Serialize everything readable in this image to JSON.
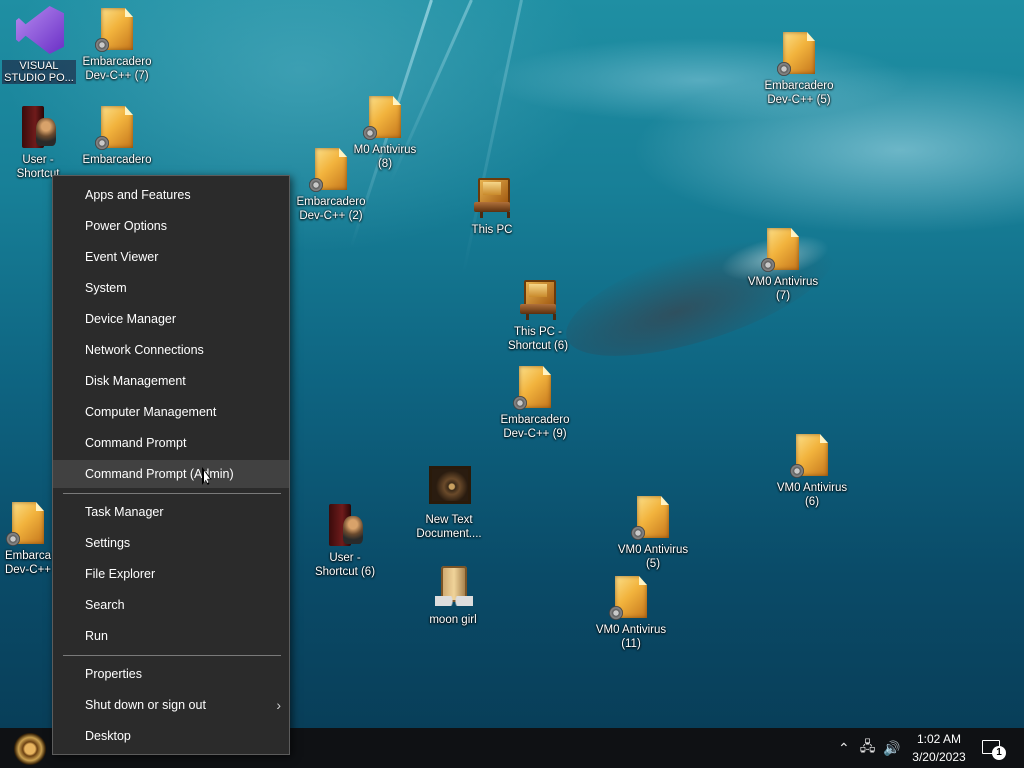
{
  "desktop": {
    "icons": [
      {
        "id": "vs",
        "label": "VISUAL STUDIO PO...",
        "overlay": "V'OVRAL S"
      },
      {
        "id": "dev7",
        "label": "Embarcadero Dev-C++ (7)"
      },
      {
        "id": "user1",
        "label": "User - Shortcut"
      },
      {
        "id": "dev_top2",
        "label": "Embarcadero"
      },
      {
        "id": "m0_8",
        "label": "M0 Antivirus (8)"
      },
      {
        "id": "dev2",
        "label": "Embarcadero Dev-C++ (2)"
      },
      {
        "id": "thispc",
        "label": "This PC"
      },
      {
        "id": "dev5",
        "label": "Embarcadero Dev-C++ (5)"
      },
      {
        "id": "vm0_7",
        "label": "VM0 Antivirus (7)"
      },
      {
        "id": "thispc6",
        "label": "This PC - Shortcut (6)"
      },
      {
        "id": "dev9",
        "label": "Embarcadero Dev-C++ (9)"
      },
      {
        "id": "vm0_6",
        "label": "VM0 Antivirus (6)"
      },
      {
        "id": "newtext",
        "label": "New Text Document...."
      },
      {
        "id": "vm0_5",
        "label": "VM0 Antivirus (5)"
      },
      {
        "id": "user6",
        "label": "User - Shortcut (6)"
      },
      {
        "id": "moon",
        "label": "moon girl"
      },
      {
        "id": "vm0_11",
        "label": "VM0 Antivirus (11)"
      },
      {
        "id": "dev_left",
        "label": "Embarca Dev-C++"
      }
    ]
  },
  "menu": {
    "groups": [
      [
        "Apps and Features",
        "Power Options",
        "Event Viewer",
        "System",
        "Device Manager",
        "Network Connections",
        "Disk Management",
        "Computer Management",
        "Command Prompt",
        "Command Prompt (Admin)"
      ],
      [
        "Task Manager",
        "Settings",
        "File Explorer",
        "Search",
        "Run"
      ],
      [
        "Properties",
        "Shut down or sign out",
        "Desktop"
      ]
    ],
    "submenu_arrow": "›"
  },
  "taskbar": {
    "time": "1:02 AM",
    "date": "3/20/2023",
    "notification_count": "1",
    "tray_icons": [
      "chevron-up-icon",
      "network-icon",
      "volume-icon"
    ]
  }
}
